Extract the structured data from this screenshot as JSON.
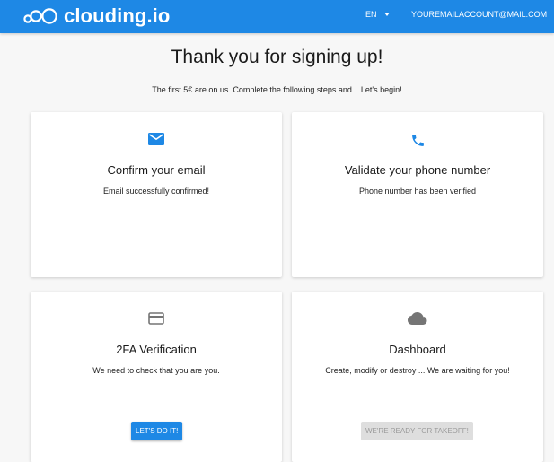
{
  "header": {
    "brand": "clouding.io",
    "language": "EN",
    "account": "YOUREMAILACCOUNT@MAIL.COM",
    "background_color": "#1e88e5"
  },
  "main": {
    "title": "Thank you for signing up!",
    "subtitle": "The first 5€ are on us. Complete the following steps and... Let's begin!"
  },
  "cards": [
    {
      "icon": "email-icon",
      "title": "Confirm your email",
      "text": "Email successfully confirmed!"
    },
    {
      "icon": "phone-icon",
      "title": "Validate your phone number",
      "text": "Phone number has been verified"
    },
    {
      "icon": "credit-card-icon",
      "title": "2FA Verification",
      "text": "We need to check that you are you.",
      "button": "LET'S DO IT!"
    },
    {
      "icon": "cloud-icon",
      "title": "Dashboard",
      "text": "Create, modify or destroy ... We are waiting for you!",
      "button": "WE'RE READY FOR TAKEOFF!",
      "button_state": "disabled"
    }
  ],
  "colors": {
    "accent": "#1e88e5",
    "icon_inactive": "#757575"
  }
}
